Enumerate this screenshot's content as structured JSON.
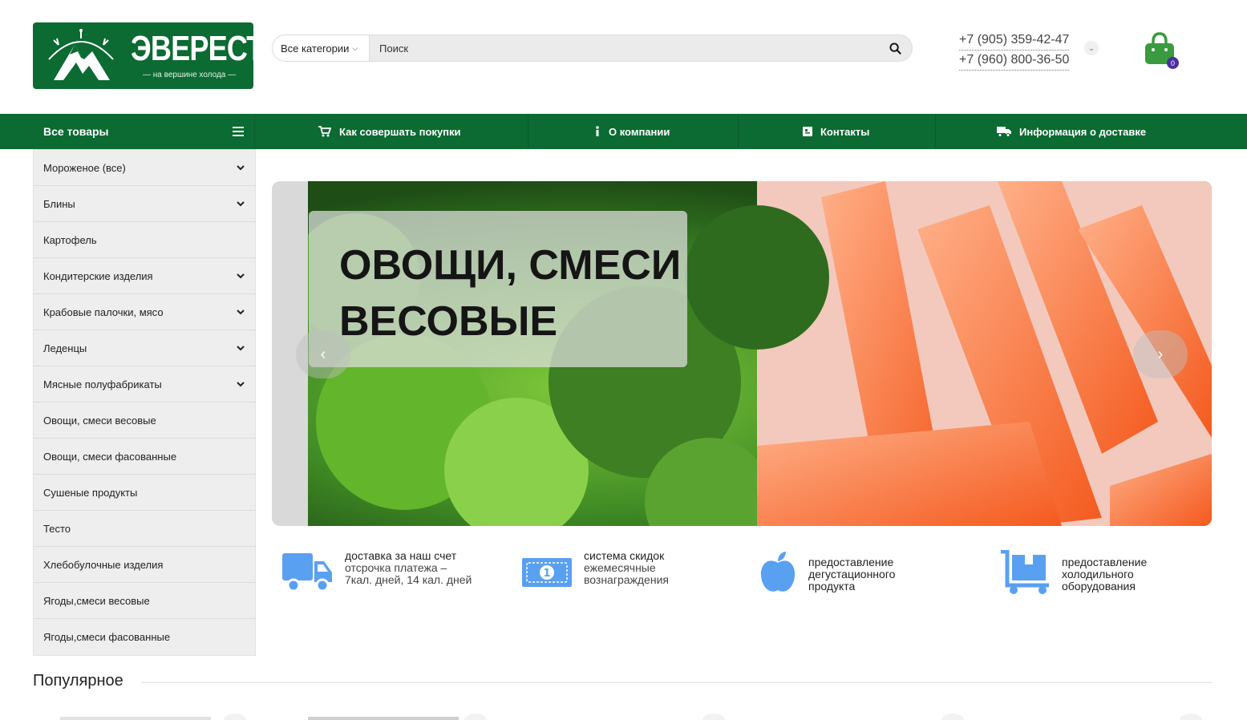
{
  "header": {
    "logo": {
      "title": "ЭВЕРЕСТ",
      "subtitle": "— на вершине холода —"
    },
    "search": {
      "category": "Все категории",
      "placeholder": "Поиск"
    },
    "phones": [
      "+7 (905) 359-42-47",
      "+7 (960) 800-36-50"
    ],
    "cart": {
      "count": "0"
    }
  },
  "nav": {
    "all_products": "Все товары",
    "items": [
      {
        "label": "Как совершать покупки",
        "icon": "cart-icon"
      },
      {
        "label": "О компании",
        "icon": "info-icon"
      },
      {
        "label": "Контакты",
        "icon": "contact-card-icon"
      },
      {
        "label": "Информация о доставке",
        "icon": "truck-icon"
      }
    ]
  },
  "sidebar": {
    "items": [
      {
        "label": "Мороженое (все)",
        "has_children": true
      },
      {
        "label": "Блины",
        "has_children": true
      },
      {
        "label": "Картофель",
        "has_children": false
      },
      {
        "label": "Кондитерские изделия",
        "has_children": true
      },
      {
        "label": "Крабовые палочки, мясо",
        "has_children": true
      },
      {
        "label": "Леденцы",
        "has_children": true
      },
      {
        "label": "Мясные полуфабрикаты",
        "has_children": true
      },
      {
        "label": "Овощи, смеси весовые",
        "has_children": false
      },
      {
        "label": "Овощи, смеси фасованные",
        "has_children": false
      },
      {
        "label": "Сушеные продукты",
        "has_children": false
      },
      {
        "label": "Тесто",
        "has_children": false
      },
      {
        "label": "Хлебобулочные изделия",
        "has_children": false
      },
      {
        "label": "Ягоды,смеси весовые",
        "has_children": false
      },
      {
        "label": "Ягоды,смеси фасованные",
        "has_children": false
      }
    ]
  },
  "banner": {
    "title_line1": "ОВОЩИ, СМЕСИ",
    "title_line2": "ВЕСОВЫЕ"
  },
  "features": [
    {
      "title": "доставка за наш счет",
      "line2": "отсрочка платежа –",
      "line3": "7кал. дней, 14 кал. дней",
      "icon": "delivery-truck-icon"
    },
    {
      "title": "система скидок",
      "line2": "ежемесячные",
      "line3": "вознаграждения",
      "icon": "money-bill-icon"
    },
    {
      "title": "предоставление",
      "line2": "дегустационного",
      "line3": "продукта",
      "icon": "apple-icon"
    },
    {
      "title": "предоставление",
      "line2": "холодильного",
      "line3": "оборудования",
      "icon": "dolly-icon"
    }
  ],
  "popular": {
    "title": "Популярное"
  },
  "colors": {
    "brand_green": "#0b6b32",
    "feature_blue": "#5aa0f0",
    "cart_green": "#3a9a3f",
    "badge_purple": "#4b2fa0"
  }
}
